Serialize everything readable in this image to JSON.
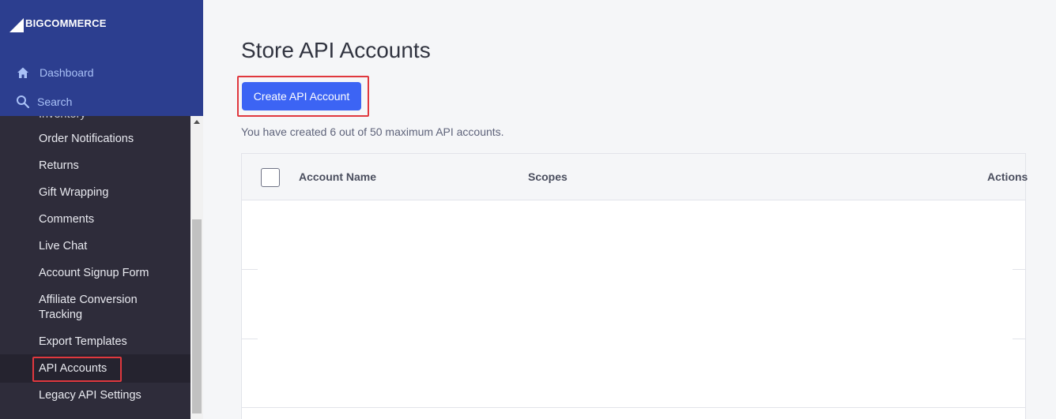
{
  "brand": {
    "logo_text": "BIGCOMMERCE"
  },
  "sidebar": {
    "top_links": [
      {
        "label": "Dashboard",
        "icon": "home-icon"
      },
      {
        "label": "Search",
        "icon": "search-icon"
      }
    ],
    "clipped_item": "Inventory",
    "items": [
      {
        "label": "Order Notifications"
      },
      {
        "label": "Returns"
      },
      {
        "label": "Gift Wrapping"
      },
      {
        "label": "Comments"
      },
      {
        "label": "Live Chat"
      },
      {
        "label": "Account Signup Form"
      },
      {
        "label": "Affiliate Conversion Tracking"
      },
      {
        "label": "Export Templates"
      },
      {
        "label": "API Accounts",
        "active": true
      },
      {
        "label": "Legacy API Settings"
      }
    ]
  },
  "main": {
    "title": "Store API Accounts",
    "create_button": "Create API Account",
    "info": "You have created 6 out of 50 maximum API accounts.",
    "table": {
      "columns": [
        "Account Name",
        "Scopes",
        "Actions"
      ]
    }
  },
  "colors": {
    "sidebar_bg": "#2e2c3a",
    "sidebar_top_bg": "#2c3e8f",
    "primary_button": "#3c64f4",
    "highlight": "#e0383e"
  }
}
